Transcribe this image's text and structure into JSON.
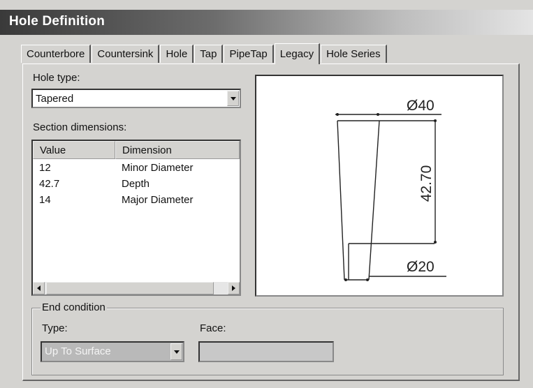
{
  "window": {
    "title": "Hole Definition"
  },
  "tabs": [
    {
      "label": "Counterbore"
    },
    {
      "label": "Countersink"
    },
    {
      "label": "Hole"
    },
    {
      "label": "Tap"
    },
    {
      "label": "PipeTap"
    },
    {
      "label": "Legacy",
      "active": true
    },
    {
      "label": "Hole Series"
    }
  ],
  "hole_type": {
    "label": "Hole type:",
    "value": "Tapered"
  },
  "section_dimensions": {
    "label": "Section dimensions:",
    "columns": [
      "Value",
      "Dimension"
    ],
    "rows": [
      {
        "value": "12",
        "dimension": "Minor Diameter"
      },
      {
        "value": "42.7",
        "dimension": "Depth"
      },
      {
        "value": "14",
        "dimension": "Major Diameter"
      }
    ]
  },
  "preview": {
    "top_diameter": "Ø40",
    "depth": "42.70",
    "bottom_diameter": "Ø20"
  },
  "end_condition": {
    "group_label": "End condition",
    "type_label": "Type:",
    "type_value": "Up To Surface",
    "face_label": "Face:",
    "face_value": ""
  }
}
